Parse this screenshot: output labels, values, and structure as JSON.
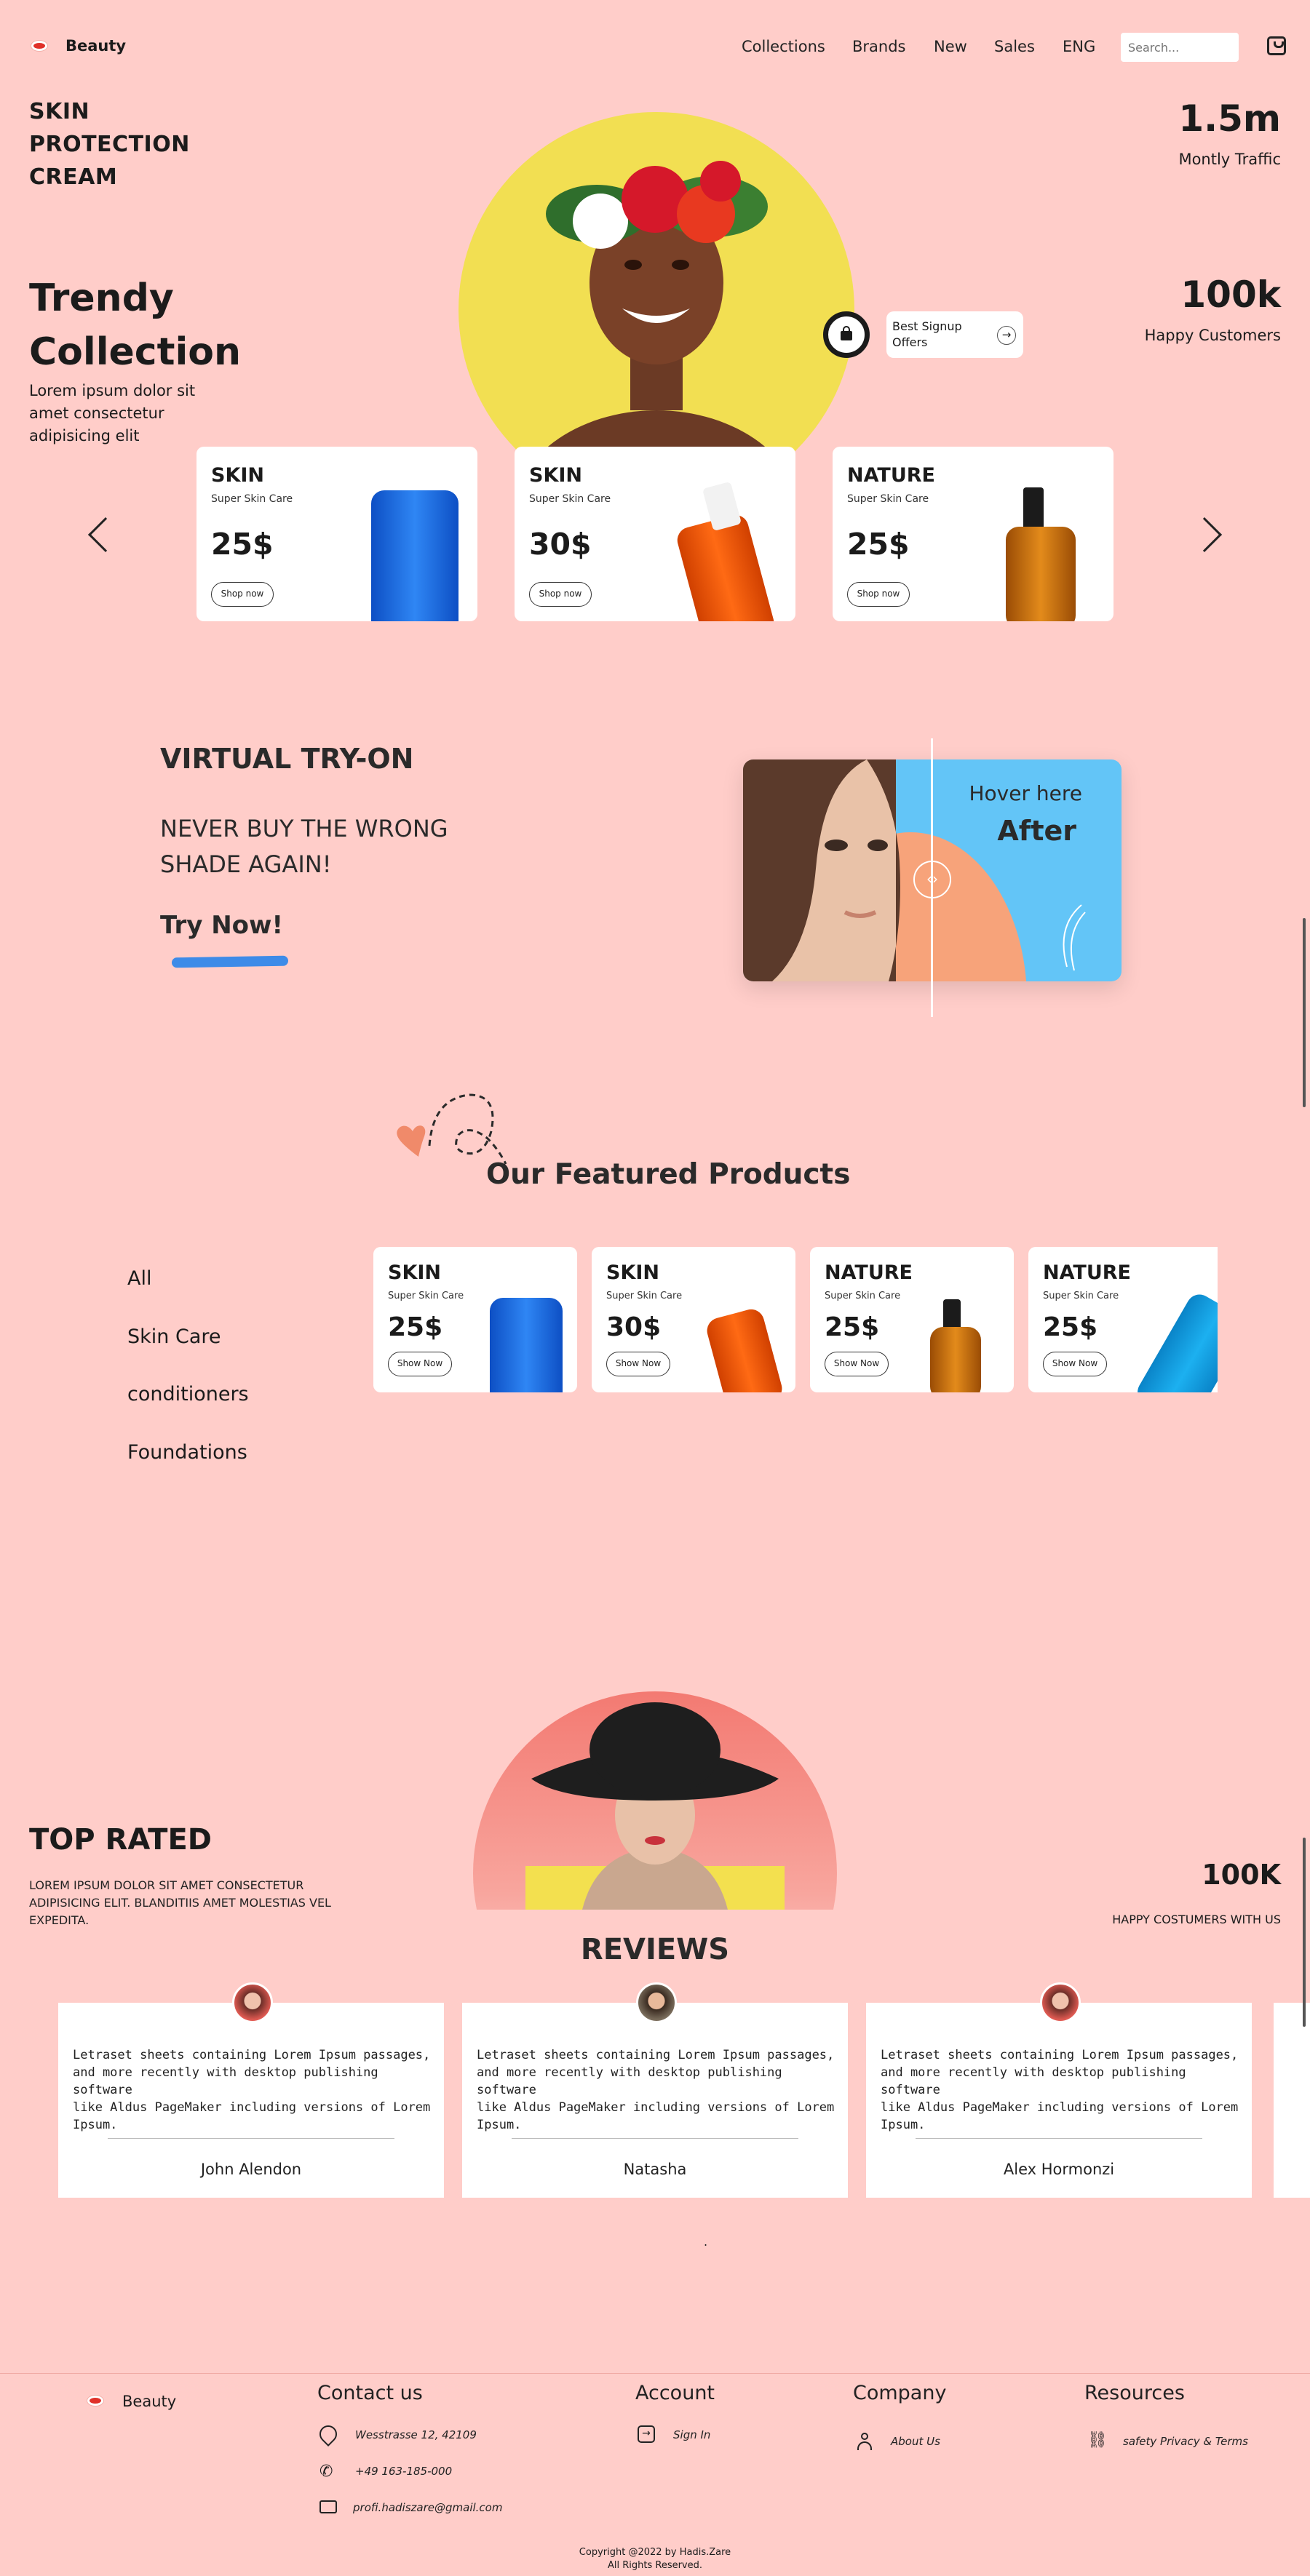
{
  "nav": {
    "brand": "Beauty",
    "links": [
      "Collections",
      "Brands",
      "New",
      "Sales",
      "ENG"
    ],
    "search_placeholder": "Search..."
  },
  "hero": {
    "small_title": [
      "SKIN",
      "PROTECTION",
      "CREAM"
    ],
    "big_title": [
      "Trendy",
      "Collection"
    ],
    "desc": [
      "Lorem ipsum dolor sit",
      "amet consectetur",
      "adipisicing elit"
    ],
    "stat1_num": "1.5m",
    "stat1_label": "Montly Traffic",
    "stat2_num": "100k",
    "stat2_label": "Happy Customers",
    "signup_text": [
      "Best Signup",
      "Offers"
    ],
    "cards": [
      {
        "title": "SKIN",
        "sub": "Super Skin Care",
        "price": "25$",
        "btn": "Shop now"
      },
      {
        "title": "SKIN",
        "sub": "Super Skin Care",
        "price": "30$",
        "btn": "Shop now"
      },
      {
        "title": "NATURE",
        "sub": "Super Skin Care",
        "price": "25$",
        "btn": "Shop now"
      }
    ]
  },
  "virtual": {
    "title": "VIRTUAL TRY-ON",
    "sub": [
      "NEVER BUY THE WRONG",
      "SHADE AGAIN!"
    ],
    "link": "Try Now!",
    "hover": "Hover here",
    "after": "After"
  },
  "featured": {
    "title": "Our Featured Products",
    "categories": [
      "All",
      "Skin Care",
      "conditioners",
      "Foundations"
    ],
    "cards": [
      {
        "title": "SKIN",
        "sub": "Super Skin Care",
        "price": "25$",
        "btn": "Show Now"
      },
      {
        "title": "SKIN",
        "sub": "Super Skin Care",
        "price": "30$",
        "btn": "Show Now"
      },
      {
        "title": "NATURE",
        "sub": "Super Skin Care",
        "price": "25$",
        "btn": "Show Now"
      },
      {
        "title": "NATURE",
        "sub": "Super Skin Care",
        "price": "25$",
        "btn": "Show Now"
      }
    ]
  },
  "top_rated": {
    "title": "TOP RATED",
    "desc": [
      "LOREM IPSUM DOLOR SIT AMET CONSECTETUR",
      "ADIPISICING ELIT. BLANDITIIS AMET MOLESTIAS VEL",
      "EXPEDITA."
    ],
    "stat_num": "100K",
    "stat_label": "HAPPY COSTUMERS WITH US"
  },
  "reviews": {
    "title": "REVIEWS",
    "items": [
      {
        "text": [
          "Letraset sheets containing Lorem Ipsum passages,",
          "and more recently with desktop publishing software",
          "like Aldus PageMaker including versions of Lorem",
          "Ipsum."
        ],
        "name": "John Alendon"
      },
      {
        "text": [
          "Letraset sheets containing Lorem Ipsum passages,",
          "and more recently with desktop publishing software",
          "like Aldus PageMaker including versions of Lorem",
          "Ipsum."
        ],
        "name": "Natasha"
      },
      {
        "text": [
          "Letraset sheets containing Lorem Ipsum passages,",
          "and more recently with desktop publishing software",
          "like Aldus PageMaker including versions of Lorem",
          "Ipsum."
        ],
        "name": "Alex Hormonzi"
      }
    ],
    "dot": "."
  },
  "footer": {
    "brand": "Beauty",
    "contact_title": "Contact us",
    "address": "Wesstrasse 12, 42109",
    "phone": "+49 163-185-000",
    "email": "profi.hadiszare@gmail.com",
    "account_title": "Account",
    "sign_in": "Sign In",
    "company_title": "Company",
    "about": "About Us",
    "resources_title": "Resources",
    "privacy": "safety Privacy & Terms",
    "copyright": "Copyright @2022 by Hadis.Zare",
    "rights": "All Rights Reserved."
  },
  "colors": {
    "background": "#ffcdc9",
    "yellow": "#f2df52",
    "sky": "#63c5f7",
    "accent_blue": "#3d8be8"
  }
}
